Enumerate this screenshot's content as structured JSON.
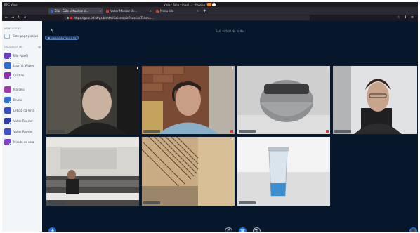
{
  "browser": {
    "app_name": "BPC Visio",
    "window_title": "Visio - Sala virtual ... - Mozilla Firefox",
    "tabs": [
      {
        "label": "Elio - Sala virtual de ci...",
        "favicon_color": "#2c76d2"
      },
      {
        "label": "Valter Monitor de...",
        "favicon_color": "#d9443a"
      },
      {
        "label": "Menu site",
        "favicon_color": "#d9443a"
      }
    ],
    "new_tab": "+",
    "url": "https://gerc.inf.ufrgs.br/html5client/join?sessionToken=...",
    "nav": {
      "back": "←",
      "forward": "→",
      "reload": "↻",
      "home": "⌂"
    },
    "nav_icons": "☆ ⬇ ≡"
  },
  "sidebar": {
    "messages_section": "MENSAGENS",
    "notes_label": "Bate-papo público",
    "users_section": "USUÁRIOS (8)",
    "users": [
      {
        "name": "Elio (Você)",
        "color": "#6b3fc2"
      },
      {
        "name": "Luan G. Weber",
        "color": "#2f6fd2"
      },
      {
        "name": "Cristian",
        "color": "#8e2fb7"
      },
      {
        "name": "Marcelo",
        "color": "#a43aa8"
      },
      {
        "name": "Bruno",
        "color": "#2f6fd2"
      },
      {
        "name": "Letícia da Silva",
        "color": "#3a4fc2"
      },
      {
        "name": "Valter Roesler",
        "color": "#2e3ea6"
      },
      {
        "name": "Valter Roesler",
        "color": "#4450c8"
      },
      {
        "name": "Minuta da sala",
        "color": "#7b44c6"
      }
    ]
  },
  "main": {
    "close_icon": "✕",
    "meeting_title": "Sala virtual do Valter",
    "recording_badge": "GRAVAÇÃO 00:01:33",
    "add_button": "+",
    "controls": [
      "🎤",
      "☎",
      "📷"
    ],
    "share_button": "⬛"
  },
  "colors": {
    "accent": "#1a73e8",
    "page_bg": "#06172b",
    "sidebar_bg": "#f3f6f9"
  }
}
